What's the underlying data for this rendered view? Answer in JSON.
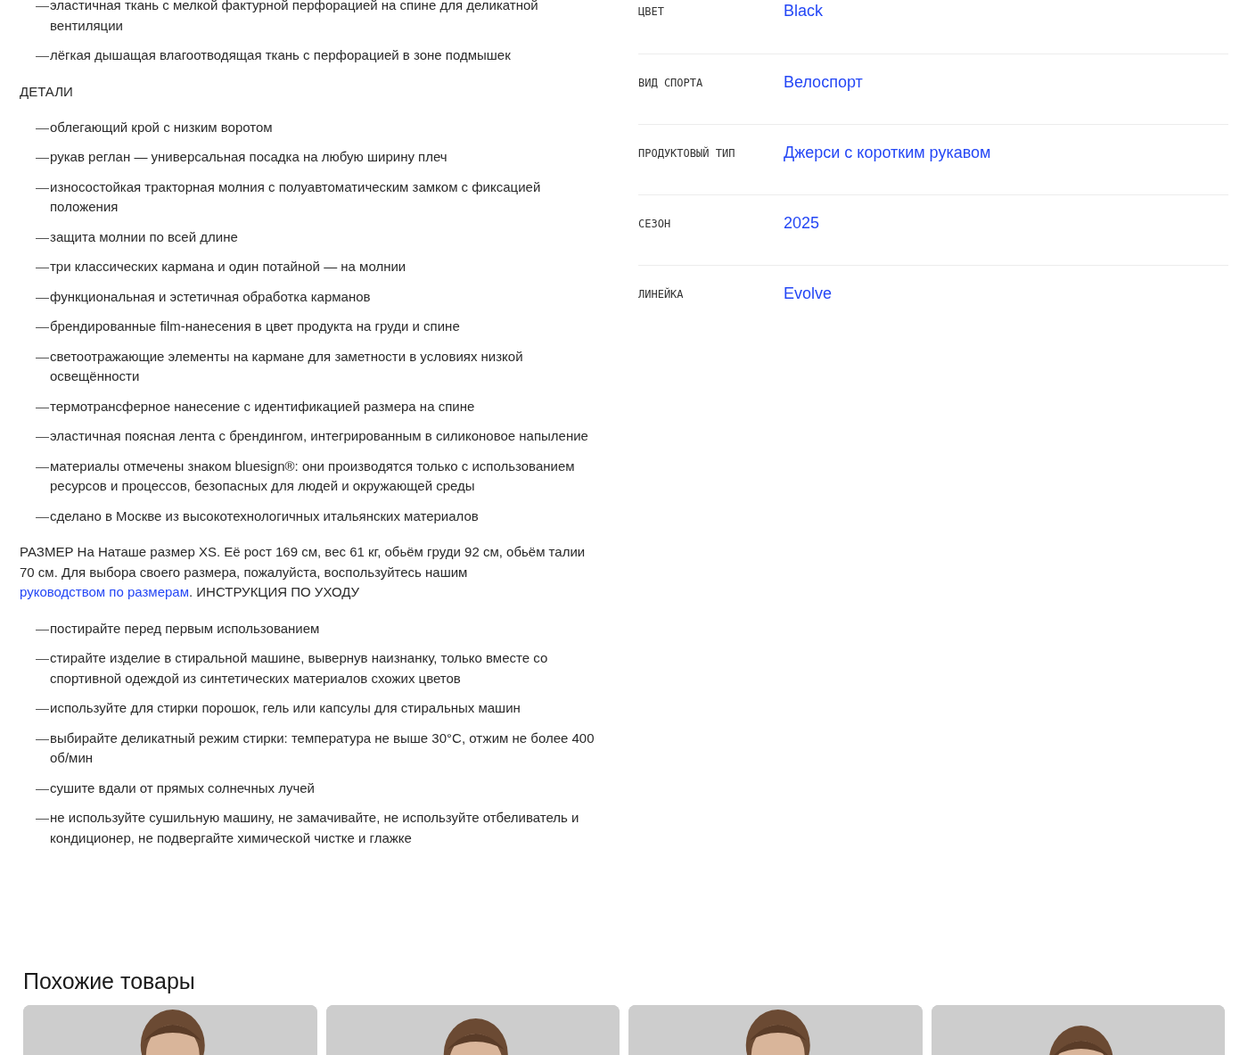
{
  "description": {
    "features_list": {
      "marker": "—",
      "items": [
        "эластичная ткань с мелкой фактурной перфорацией на спине для деликатной вентиляции",
        "лёгкая дышащая влагоотводящая ткань с перфорацией в зоне подмышек"
      ]
    },
    "details": {
      "heading": "ДЕТАЛИ",
      "marker": "—",
      "items": [
        "облегающий крой с низким воротом",
        "рукав реглан — универсальная посадка на любую ширину плеч",
        "износостойкая тракторная молния с полуавтоматическим замком с фиксацией положения",
        "защита молнии по всей длине",
        "три классических кармана и один потайной — на молнии",
        "функциональная и эстетичная обработка карманов",
        "брендированные film-нанесения в цвет продукта на груди и спине",
        "светоотражающие элементы на кармане для заметности в условиях низкой освещённости",
        "термотрансферное нанесение с идентификацией размера на спине",
        "эластичная поясная лента с брендингом, интегрированным в силиконовое напыление",
        "материалы отмечены знаком bluesign®: они производятся только с использованием ресурсов и процессов, безопасных для людей и окружающей среды",
        "сделано в Москве из высокотехнологичных итальянских материалов"
      ]
    },
    "size_paragraph": {
      "before": "РАЗМЕР На Наташе размер XS. Её рост 169 см, вес 61 кг, обьём груди 92 см, обьём талии 70 см. Для выбора своего размера, пожалуйста, воспользуйтесь нашим",
      "link": "руководством по размерам",
      "after": ". ИНСТРУКЦИЯ ПО УХОДУ"
    },
    "care_list": {
      "marker": "—",
      "items": [
        "постирайте перед первым использованием",
        "стирайте изделие в стиральной машине, вывернув наизнанку, только вместе со спортивной одеждой из синтетических материалов схожих цветов",
        "используйте для стирки порошок, гель или капсулы для стиральных машин",
        "выбирайте деликатный режим стирки: температура не выше 30°C, отжим не более 400 об/мин",
        "сушите вдали от прямых солнечных лучей",
        "не используйте сушильную машину, не замачивайте, не используйте отбеливатель и кондиционер, не подвергайте химической чистке и глажке"
      ]
    }
  },
  "attributes": [
    {
      "label": "ЦВЕТ",
      "value": "Black"
    },
    {
      "label": "ВИД СПОРТА",
      "value": "Велоспорт"
    },
    {
      "label": "ПРОДУКТОВЫЙ ТИП",
      "value": "Джерси с коротким рукавом"
    },
    {
      "label": "СЕЗОН",
      "value": "2025"
    },
    {
      "label": "ЛИНЕЙКА",
      "value": "Evolve"
    }
  ],
  "similar_products": {
    "title": "Похожие товары"
  }
}
